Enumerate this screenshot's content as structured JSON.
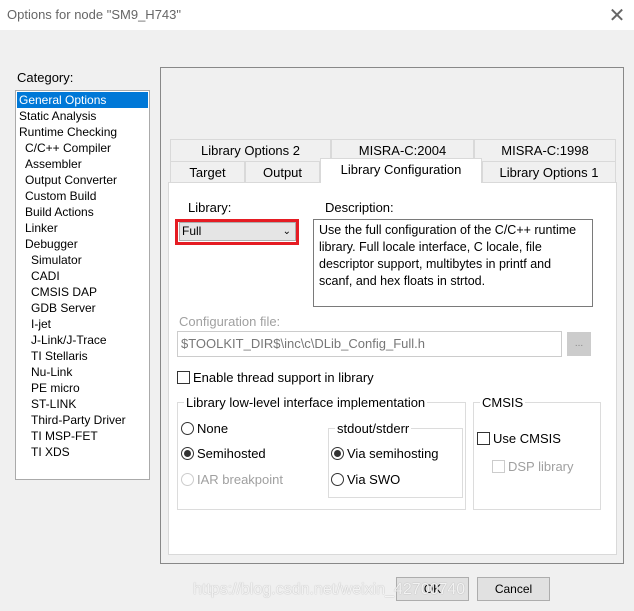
{
  "window": {
    "title": "Options for node \"SM9_H743\"",
    "close_icon": "close-icon",
    "close_glyph": "✕"
  },
  "category": {
    "label": "Category:",
    "items": [
      {
        "label": "General Options",
        "level": 0,
        "selected": true
      },
      {
        "label": "Static Analysis",
        "level": 0
      },
      {
        "label": "Runtime Checking",
        "level": 0
      },
      {
        "label": "C/C++ Compiler",
        "level": 1
      },
      {
        "label": "Assembler",
        "level": 1
      },
      {
        "label": "Output Converter",
        "level": 1
      },
      {
        "label": "Custom Build",
        "level": 1
      },
      {
        "label": "Build Actions",
        "level": 1
      },
      {
        "label": "Linker",
        "level": 1
      },
      {
        "label": "Debugger",
        "level": 1
      },
      {
        "label": "Simulator",
        "level": 2
      },
      {
        "label": "CADI",
        "level": 2
      },
      {
        "label": "CMSIS DAP",
        "level": 2
      },
      {
        "label": "GDB Server",
        "level": 2
      },
      {
        "label": "I-jet",
        "level": 2
      },
      {
        "label": "J-Link/J-Trace",
        "level": 2
      },
      {
        "label": "TI Stellaris",
        "level": 2
      },
      {
        "label": "Nu-Link",
        "level": 2
      },
      {
        "label": "PE micro",
        "level": 2
      },
      {
        "label": "ST-LINK",
        "level": 2
      },
      {
        "label": "Third-Party Driver",
        "level": 2
      },
      {
        "label": "TI MSP-FET",
        "level": 2
      },
      {
        "label": "TI XDS",
        "level": 2
      }
    ]
  },
  "tabs": {
    "row1": [
      "Library Options 2",
      "MISRA-C:2004",
      "MISRA-C:1998"
    ],
    "row2": [
      "Target",
      "Output",
      "Library Configuration",
      "Library Options 1"
    ],
    "selected": "Library Configuration"
  },
  "library": {
    "label": "Library:",
    "value": "Full",
    "highlight_color": "#e51c23"
  },
  "description": {
    "label": "Description:",
    "text": "Use the full configuration of the C/C++ runtime library. Full locale interface, C locale, file descriptor support, multibytes in printf and scanf, and hex floats in strtod."
  },
  "config_file": {
    "label": "Configuration file:",
    "value": "$TOOLKIT_DIR$\\inc\\c\\DLib_Config_Full.h",
    "browse_label": "..."
  },
  "thread_support": {
    "label": "Enable thread support in library",
    "checked": false
  },
  "low_level": {
    "legend": "Library low-level interface implementation",
    "options": [
      {
        "label": "None",
        "checked": false
      },
      {
        "label": "Semihosted",
        "checked": true
      },
      {
        "label": "IAR breakpoint",
        "checked": false,
        "disabled": true
      }
    ]
  },
  "stdout": {
    "legend": "stdout/stderr",
    "options": [
      {
        "label": "Via semihosting",
        "checked": true
      },
      {
        "label": "Via SWO",
        "checked": false
      }
    ]
  },
  "cmsis": {
    "legend": "CMSIS",
    "use_cmsis": {
      "label": "Use CMSIS",
      "checked": false
    },
    "dsp": {
      "label": "DSP library",
      "checked": false,
      "disabled": true
    }
  },
  "buttons": {
    "ok": "OK",
    "cancel": "Cancel"
  },
  "watermark": "https://blog.csdn.net/weixin_42700740",
  "colors": {
    "selection": "#0078d7"
  }
}
